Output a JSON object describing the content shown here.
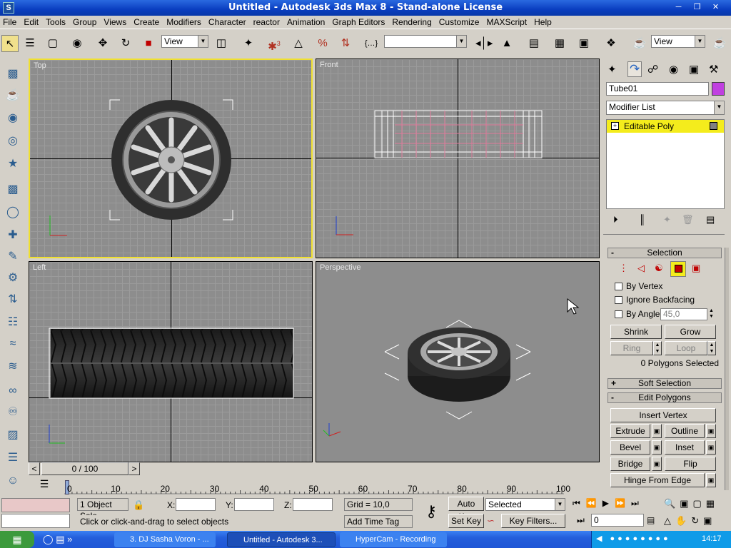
{
  "window": {
    "title": "Untitled - Autodesk 3ds Max 8  - Stand-alone License",
    "app_icon": "3ds-max-icon"
  },
  "menu": [
    "File",
    "Edit",
    "Tools",
    "Group",
    "Views",
    "Create",
    "Modifiers",
    "Character",
    "reactor",
    "Animation",
    "Graph Editors",
    "Rendering",
    "Customize",
    "MAXScript",
    "Help"
  ],
  "toolbar": {
    "reference_coord": "View",
    "named_selection": "",
    "snap_label": "3",
    "right_view": "View"
  },
  "viewports": {
    "top": "Top",
    "front": "Front",
    "left": "Left",
    "perspective": "Perspective"
  },
  "command_panel": {
    "object_name": "Tube01",
    "object_color": "#c040e0",
    "modifier_list": "Modifier List",
    "stack_item": "Editable Poly",
    "selection_title": "Selection",
    "by_vertex": "By Vertex",
    "ignore_backfacing": "Ignore Backfacing",
    "by_angle": "By Angle:",
    "by_angle_value": "45,0",
    "shrink": "Shrink",
    "grow": "Grow",
    "ring": "Ring",
    "loop": "Loop",
    "selection_status": "0 Polygons Selected",
    "soft_selection": "Soft Selection",
    "edit_polygons": "Edit Polygons",
    "insert_vertex": "Insert Vertex",
    "extrude": "Extrude",
    "outline": "Outline",
    "bevel": "Bevel",
    "inset": "Inset",
    "bridge": "Bridge",
    "flip": "Flip",
    "hinge_from_edge": "Hinge From Edge"
  },
  "timeline": {
    "slider": "0 / 100",
    "ticks": [
      "0",
      "10",
      "20",
      "30",
      "40",
      "50",
      "60",
      "70",
      "80",
      "90",
      "100"
    ]
  },
  "status": {
    "selection": "1 Object Sele",
    "x_label": "X:",
    "y_label": "Y:",
    "z_label": "Z:",
    "grid": "Grid = 10,0",
    "prompt": "Click or click-and-drag to select objects",
    "add_time_tag": "Add Time Tag",
    "auto_key": "Auto Key",
    "set_key": "Set Key",
    "key_mode": "Selected",
    "key_filters": "Key Filters...",
    "frame": "0"
  },
  "taskbar": {
    "tasks": [
      "3. DJ Sasha Voron - ...",
      "Untitled - Autodesk 3...",
      "HyperCam - Recording"
    ],
    "clock": "14:17"
  }
}
